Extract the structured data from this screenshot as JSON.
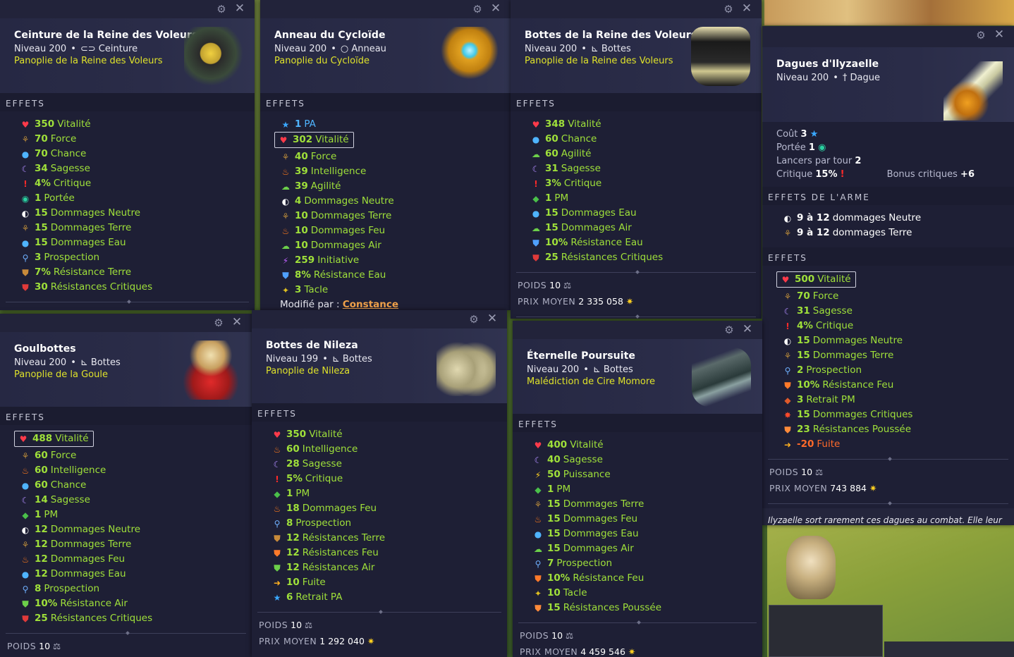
{
  "panels": {
    "ceinture": {
      "name": "Ceinture de la Reine des Voleurs",
      "level": "Niveau 200",
      "type": "Ceinture",
      "set": "Panoplie de la Reine des Voleurs",
      "section": "EFFETS",
      "effects": [
        {
          "icon": "heart",
          "n": "350",
          "t": "Vitalité"
        },
        {
          "icon": "earth",
          "n": "70",
          "t": "Force"
        },
        {
          "icon": "water",
          "n": "70",
          "t": "Chance"
        },
        {
          "icon": "moon",
          "n": "34",
          "t": "Sagesse"
        },
        {
          "icon": "crit",
          "n": "4%",
          "t": "Critique"
        },
        {
          "icon": "eye",
          "n": "1",
          "t": "Portée"
        },
        {
          "icon": "neutral",
          "n": "15",
          "t": "Dommages Neutre"
        },
        {
          "icon": "earth",
          "n": "15",
          "t": "Dommages Terre"
        },
        {
          "icon": "water",
          "n": "15",
          "t": "Dommages Eau"
        },
        {
          "icon": "pp",
          "n": "3",
          "t": "Prospection"
        },
        {
          "icon": "shield-earth",
          "n": "7%",
          "t": "Résistance Terre"
        },
        {
          "icon": "shield-crit",
          "n": "30",
          "t": "Résistances Critiques"
        }
      ]
    },
    "anneau": {
      "name": "Anneau du Cycloïde",
      "level": "Niveau 200",
      "type": "Anneau",
      "set": "Panoplie du Cycloïde",
      "section": "EFFETS",
      "effects": [
        {
          "icon": "star",
          "n": "1",
          "t": "PA",
          "blue": true
        },
        {
          "icon": "heart",
          "n": "302",
          "t": "Vitalité",
          "boxed": true
        },
        {
          "icon": "earth",
          "n": "40",
          "t": "Force"
        },
        {
          "icon": "fire",
          "n": "39",
          "t": "Intelligence"
        },
        {
          "icon": "air",
          "n": "39",
          "t": "Agilité"
        },
        {
          "icon": "neutral",
          "n": "4",
          "t": "Dommages Neutre"
        },
        {
          "icon": "earth",
          "n": "10",
          "t": "Dommages Terre"
        },
        {
          "icon": "fire",
          "n": "10",
          "t": "Dommages Feu"
        },
        {
          "icon": "air",
          "n": "10",
          "t": "Dommages Air"
        },
        {
          "icon": "init",
          "n": "259",
          "t": "Initiative"
        },
        {
          "icon": "shield-water",
          "n": "8%",
          "t": "Résistance Eau"
        },
        {
          "icon": "tackle",
          "n": "3",
          "t": "Tacle"
        }
      ],
      "modified_label": "Modifié par :",
      "modified_by": "Constance"
    },
    "bottes_reine": {
      "name": "Bottes de la Reine des Voleurs",
      "level": "Niveau 200",
      "type": "Bottes",
      "set": "Panoplie de la Reine des Voleurs",
      "section": "EFFETS",
      "effects": [
        {
          "icon": "heart",
          "n": "348",
          "t": "Vitalité"
        },
        {
          "icon": "water",
          "n": "60",
          "t": "Chance"
        },
        {
          "icon": "air",
          "n": "60",
          "t": "Agilité"
        },
        {
          "icon": "moon",
          "n": "31",
          "t": "Sagesse"
        },
        {
          "icon": "crit",
          "n": "3%",
          "t": "Critique"
        },
        {
          "icon": "pm",
          "n": "1",
          "t": "PM"
        },
        {
          "icon": "water",
          "n": "15",
          "t": "Dommages Eau"
        },
        {
          "icon": "air",
          "n": "15",
          "t": "Dommages Air"
        },
        {
          "icon": "shield-water",
          "n": "10%",
          "t": "Résistance Eau"
        },
        {
          "icon": "shield-crit",
          "n": "25",
          "t": "Résistances Critiques"
        }
      ],
      "weight_label": "POIDS",
      "weight": "10",
      "price_label": "PRIX MOYEN",
      "price": "2 335 058"
    },
    "dagues": {
      "name": "Dagues d'Ilyzaelle",
      "level": "Niveau 200",
      "type": "Dague",
      "cost_label": "Coût",
      "cost": "3",
      "range_label": "Portée",
      "range": "1",
      "casts_label": "Lancers par tour",
      "casts": "2",
      "crit_label": "Critique",
      "crit": "15%",
      "crit_bonus_label": "Bonus critiques",
      "crit_bonus": "+6",
      "weapon_section": "EFFETS DE L'ARME",
      "weapon_effects": [
        {
          "icon": "neutral",
          "n": "9 à 12",
          "t": "dommages Neutre",
          "white": true
        },
        {
          "icon": "earth",
          "n": "9 à 12",
          "t": "dommages Terre",
          "white": true
        }
      ],
      "section": "EFFETS",
      "effects": [
        {
          "icon": "heart",
          "n": "500",
          "t": "Vitalité",
          "boxed": true
        },
        {
          "icon": "earth",
          "n": "70",
          "t": "Force"
        },
        {
          "icon": "moon",
          "n": "31",
          "t": "Sagesse"
        },
        {
          "icon": "crit",
          "n": "4%",
          "t": "Critique"
        },
        {
          "icon": "neutral",
          "n": "15",
          "t": "Dommages Neutre"
        },
        {
          "icon": "earth",
          "n": "15",
          "t": "Dommages Terre"
        },
        {
          "icon": "pp",
          "n": "2",
          "t": "Prospection"
        },
        {
          "icon": "shield-fire",
          "n": "10%",
          "t": "Résistance Feu"
        },
        {
          "icon": "retpm",
          "n": "3",
          "t": "Retrait PM"
        },
        {
          "icon": "critdmg",
          "n": "15",
          "t": "Dommages Critiques"
        },
        {
          "icon": "shield-push",
          "n": "23",
          "t": "Résistances Poussée"
        },
        {
          "icon": "flee",
          "n": "-20",
          "t": "Fuite",
          "neg": true
        }
      ],
      "weight_label": "POIDS",
      "weight": "10",
      "price_label": "PRIX MOYEN",
      "price": "743 884",
      "description": "Ilyzaelle sort rarement ces dagues au combat. Elle leur préfère une utilisation plus proche de celle de couteaux."
    },
    "goulbottes": {
      "name": "Goulbottes",
      "level": "Niveau 200",
      "type": "Bottes",
      "set": "Panoplie de la Goule",
      "section": "EFFETS",
      "effects": [
        {
          "icon": "heart",
          "n": "488",
          "t": "Vitalité",
          "boxed": true
        },
        {
          "icon": "earth",
          "n": "60",
          "t": "Force"
        },
        {
          "icon": "fire",
          "n": "60",
          "t": "Intelligence"
        },
        {
          "icon": "water",
          "n": "60",
          "t": "Chance"
        },
        {
          "icon": "moon",
          "n": "14",
          "t": "Sagesse"
        },
        {
          "icon": "pm",
          "n": "1",
          "t": "PM"
        },
        {
          "icon": "neutral",
          "n": "12",
          "t": "Dommages Neutre"
        },
        {
          "icon": "earth",
          "n": "12",
          "t": "Dommages Terre"
        },
        {
          "icon": "fire",
          "n": "12",
          "t": "Dommages Feu"
        },
        {
          "icon": "water",
          "n": "12",
          "t": "Dommages Eau"
        },
        {
          "icon": "pp",
          "n": "8",
          "t": "Prospection"
        },
        {
          "icon": "shield-air",
          "n": "10%",
          "t": "Résistance Air"
        },
        {
          "icon": "shield-crit",
          "n": "25",
          "t": "Résistances Critiques"
        }
      ],
      "weight_label": "POIDS",
      "weight": "10"
    },
    "nileza": {
      "name": "Bottes de Nileza",
      "level": "Niveau 199",
      "type": "Bottes",
      "set": "Panoplie de Nileza",
      "section": "EFFETS",
      "effects": [
        {
          "icon": "heart",
          "n": "350",
          "t": "Vitalité"
        },
        {
          "icon": "fire",
          "n": "60",
          "t": "Intelligence"
        },
        {
          "icon": "moon",
          "n": "28",
          "t": "Sagesse"
        },
        {
          "icon": "crit",
          "n": "5%",
          "t": "Critique"
        },
        {
          "icon": "pm",
          "n": "1",
          "t": "PM"
        },
        {
          "icon": "fire",
          "n": "18",
          "t": "Dommages Feu"
        },
        {
          "icon": "pp",
          "n": "8",
          "t": "Prospection"
        },
        {
          "icon": "shield-earth",
          "n": "12",
          "t": "Résistances Terre"
        },
        {
          "icon": "shield-fire",
          "n": "12",
          "t": "Résistances Feu"
        },
        {
          "icon": "shield-air",
          "n": "12",
          "t": "Résistances Air"
        },
        {
          "icon": "flee",
          "n": "10",
          "t": "Fuite"
        },
        {
          "icon": "retpa",
          "n": "6",
          "t": "Retrait PA"
        }
      ],
      "weight_label": "POIDS",
      "weight": "10",
      "price_label": "PRIX MOYEN",
      "price": "1 292 040"
    },
    "eternelle": {
      "name": "Éternelle Poursuite",
      "level": "Niveau 200",
      "type": "Bottes",
      "set": "Malédiction de Cire Momore",
      "section": "EFFETS",
      "effects": [
        {
          "icon": "heart",
          "n": "400",
          "t": "Vitalité"
        },
        {
          "icon": "moon",
          "n": "40",
          "t": "Sagesse"
        },
        {
          "icon": "power",
          "n": "50",
          "t": "Puissance"
        },
        {
          "icon": "pm",
          "n": "1",
          "t": "PM"
        },
        {
          "icon": "earth",
          "n": "15",
          "t": "Dommages Terre"
        },
        {
          "icon": "fire",
          "n": "15",
          "t": "Dommages Feu"
        },
        {
          "icon": "water",
          "n": "15",
          "t": "Dommages Eau"
        },
        {
          "icon": "air",
          "n": "15",
          "t": "Dommages Air"
        },
        {
          "icon": "pp",
          "n": "7",
          "t": "Prospection"
        },
        {
          "icon": "shield-fire",
          "n": "10%",
          "t": "Résistance Feu"
        },
        {
          "icon": "tackle",
          "n": "10",
          "t": "Tacle"
        },
        {
          "icon": "shield-push",
          "n": "15",
          "t": "Résistances Poussée"
        }
      ],
      "weight_label": "POIDS",
      "weight": "10",
      "price_label": "PRIX MOYEN",
      "price": "4 459 546"
    }
  },
  "icons": {
    "heart": {
      "glyph": "♥",
      "color": "#ff3a4a"
    },
    "earth": {
      "glyph": "⚘",
      "color": "#b98a3a"
    },
    "water": {
      "glyph": "●",
      "color": "#4fb4ff"
    },
    "moon": {
      "glyph": "☾",
      "color": "#b08cff"
    },
    "crit": {
      "glyph": "!",
      "color": "#ff2a2a"
    },
    "eye": {
      "glyph": "◉",
      "color": "#2ad0a0"
    },
    "neutral": {
      "glyph": "◐",
      "color": "#ffffff"
    },
    "pp": {
      "glyph": "⚲",
      "color": "#6fb0ff"
    },
    "shield-earth": {
      "glyph": "⛊",
      "color": "#c88a3a"
    },
    "shield-crit": {
      "glyph": "⛊",
      "color": "#e03a3a"
    },
    "shield-water": {
      "glyph": "⛊",
      "color": "#4fa0ff"
    },
    "shield-fire": {
      "glyph": "⛊",
      "color": "#ff7a2a"
    },
    "shield-air": {
      "glyph": "⛊",
      "color": "#6ccf4a"
    },
    "shield-push": {
      "glyph": "⛊",
      "color": "#ff8a3a"
    },
    "star": {
      "glyph": "★",
      "color": "#3aa8ff"
    },
    "fire": {
      "glyph": "♨",
      "color": "#ff7a1a"
    },
    "air": {
      "glyph": "☁",
      "color": "#6ccf4a"
    },
    "init": {
      "glyph": "⚡",
      "color": "#c060ff"
    },
    "tackle": {
      "glyph": "✦",
      "color": "#e0c020"
    },
    "pm": {
      "glyph": "◆",
      "color": "#4ac04a"
    },
    "power": {
      "glyph": "⚡",
      "color": "#ffd020"
    },
    "retpm": {
      "glyph": "◆",
      "color": "#e05a2a"
    },
    "critdmg": {
      "glyph": "✸",
      "color": "#ff4a2a"
    },
    "flee": {
      "glyph": "➜",
      "color": "#ffb020"
    },
    "retpa": {
      "glyph": "★",
      "color": "#3aa8ff"
    }
  }
}
